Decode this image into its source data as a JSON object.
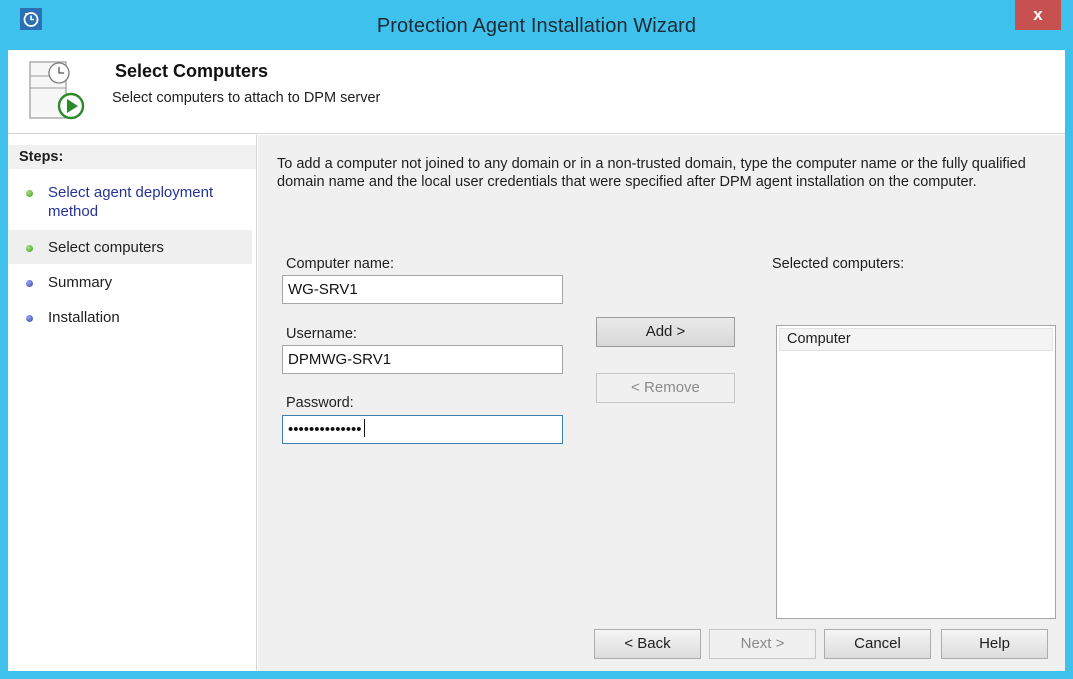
{
  "window": {
    "title": "Protection Agent Installation Wizard",
    "close_label": "x",
    "accent_color": "#3fc1ee"
  },
  "header": {
    "title": "Select Computers",
    "subtitle": "Select computers to attach to DPM server",
    "icon": "protection-agent-icon"
  },
  "steps": {
    "heading": "Steps:",
    "items": [
      {
        "label": "Select agent deployment method",
        "status": "done"
      },
      {
        "label": "Select computers",
        "status": "current"
      },
      {
        "label": "Summary",
        "status": "pending"
      },
      {
        "label": "Installation",
        "status": "pending"
      }
    ]
  },
  "main": {
    "intro": "To add a computer not joined to any domain or in a non-trusted domain, type the computer name or the fully qualified domain name and the local user credentials that were specified after DPM agent installation on the computer.",
    "computer_name": {
      "label": "Computer name:",
      "value": "WG-SRV1"
    },
    "username": {
      "label": "Username:",
      "value": "DPMWG-SRV1"
    },
    "password": {
      "label": "Password:",
      "value": "••••••••••••••"
    },
    "add_button": "Add >",
    "remove_button": "< Remove",
    "selected_label": "Selected computers:",
    "selected_column": "Computer"
  },
  "footer": {
    "back": "< Back",
    "next": "Next >",
    "cancel": "Cancel",
    "help": "Help"
  }
}
